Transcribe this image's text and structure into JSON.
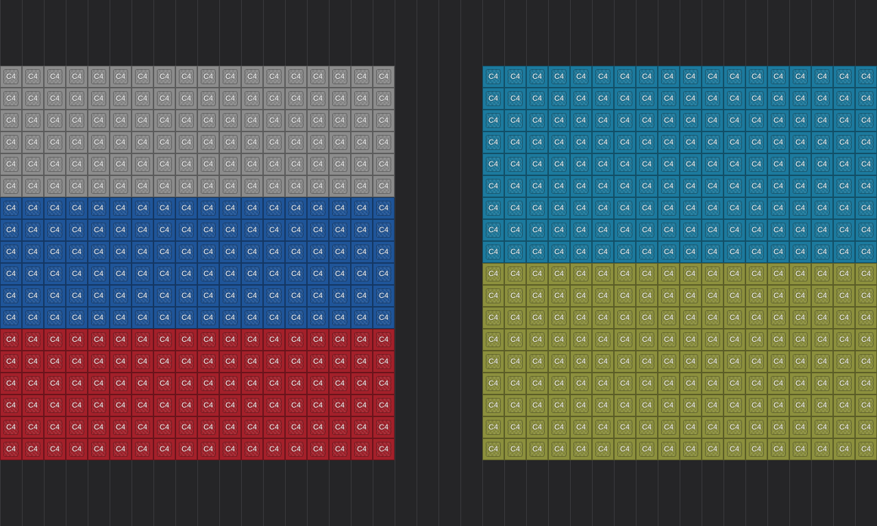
{
  "app": "MIDI piano roll editor",
  "blocks": [
    {
      "name": "left-note-block",
      "note_label": "C4",
      "columns": 18,
      "bands": [
        {
          "name": "gray",
          "color": "#8c8c8c",
          "rows": 6
        },
        {
          "name": "blue",
          "color": "#1f5599",
          "rows": 6
        },
        {
          "name": "red",
          "color": "#a4202a",
          "rows": 6
        }
      ]
    },
    {
      "name": "right-note-block",
      "note_label": "C4",
      "columns": 18,
      "bands": [
        {
          "name": "teal",
          "color": "#1c7a9e",
          "rows": 9
        },
        {
          "name": "olive",
          "color": "#8c903d",
          "rows": 9
        }
      ]
    }
  ]
}
